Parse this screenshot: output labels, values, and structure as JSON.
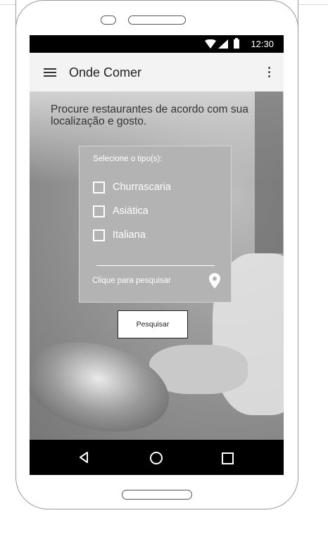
{
  "status_bar": {
    "time": "12:30"
  },
  "app_bar": {
    "title": "Onde Comer"
  },
  "intro_text": "Procure restaurantes de acordo com sua localização e gosto.",
  "filter_panel": {
    "heading": "Selecione o tipo(s):",
    "options": [
      {
        "label": "Churrascaria",
        "checked": false
      },
      {
        "label": "Asiática",
        "checked": false
      },
      {
        "label": "Italiana",
        "checked": false
      }
    ],
    "location_hint": "Clique para pesquisar"
  },
  "search_button": {
    "label": "Pesquisar"
  },
  "icons": {
    "menu": "hamburger-menu-icon",
    "more": "overflow-menu-icon",
    "location": "location-pin-icon",
    "nav_back": "back-triangle-icon",
    "nav_home": "home-circle-icon",
    "nav_recent": "recent-apps-square-icon"
  }
}
